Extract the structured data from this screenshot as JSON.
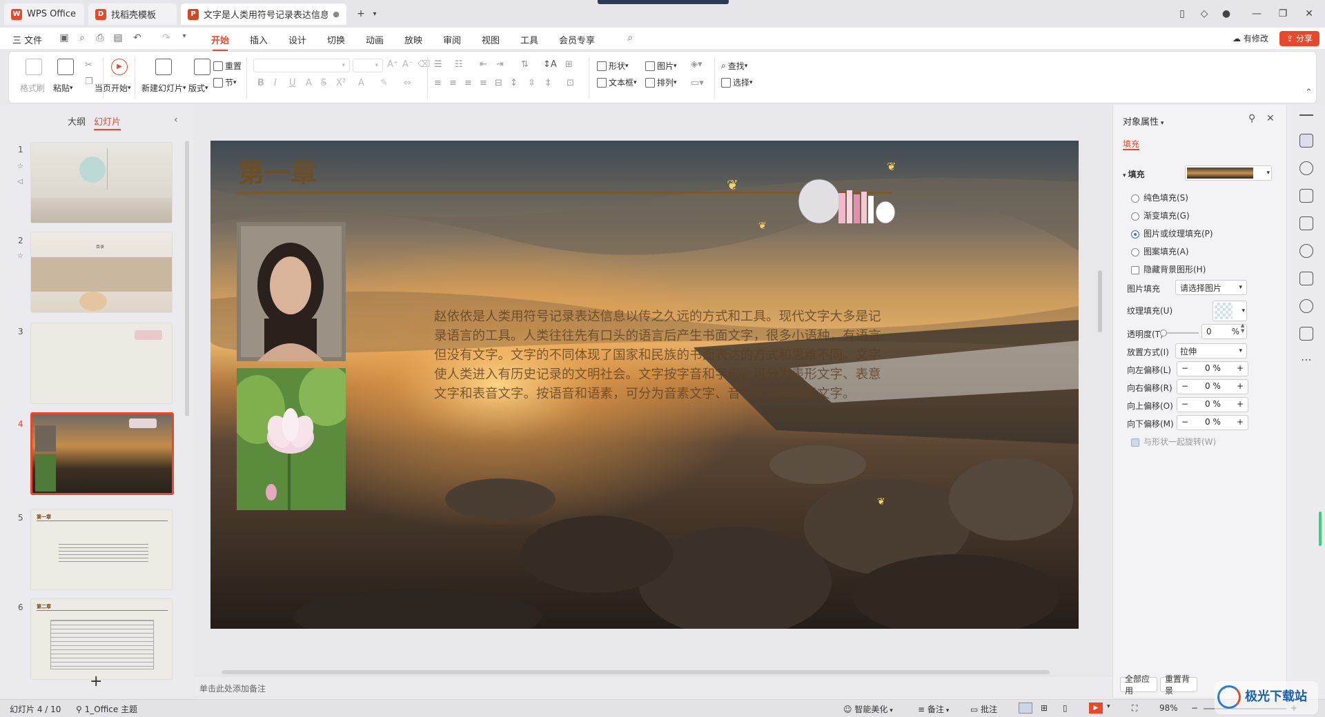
{
  "tabs": [
    {
      "label": "WPS Office",
      "icon": "wps-logo-icon",
      "color": "#e8492b"
    },
    {
      "label": "找稻壳模板",
      "icon": "docer-icon",
      "color": "#e8492b"
    },
    {
      "label": "文字是人类用符号记录表达信息以",
      "icon": "presentation-icon",
      "color": "#d24726"
    }
  ],
  "menubar": {
    "file": "三 文件",
    "items": [
      "开始",
      "插入",
      "设计",
      "切换",
      "动画",
      "放映",
      "审阅",
      "视图",
      "工具",
      "会员专享"
    ],
    "active": "开始",
    "has_changes": "有修改",
    "share": "分享"
  },
  "ribbon": {
    "format_painter": "格式刷",
    "paste": "粘贴",
    "play_from_current": "当页开始",
    "new_slide": "新建幻灯片",
    "layout": "版式",
    "section": "节",
    "reset": "重置",
    "shape": "形状",
    "picture": "图片",
    "textbox": "文本框",
    "arrange": "排列",
    "find": "查找",
    "select": "选择"
  },
  "leftpanel": {
    "outline_tab": "大纲",
    "slides_tab": "幻灯片",
    "slides": [
      {
        "num": "1"
      },
      {
        "num": "2"
      },
      {
        "num": "3"
      },
      {
        "num": "4"
      },
      {
        "num": "5"
      },
      {
        "num": "6"
      }
    ],
    "slide5_title": "第一章",
    "slide6_title": "第二章",
    "slide2_title": "目录",
    "add": "+"
  },
  "slide": {
    "title": "第一章",
    "body": "赵依依是人类用符号记录表达信息以传之久远的方式和工具。现代文字大多是记录语言的工具。人类往往先有口头的语言后产生书面文字，很多小语种，有语言但没有文字。文字的不同体现了国家和民族的书面表达的方式和思维不同。文字使人类进入有历史记录的文明社会。文字按字音和字形，可分为表形文字、表意文字和表音文字。按语音和语素，可分为音素文字、音节文字和语素文字。"
  },
  "notes_placeholder": "单击此处添加备注",
  "rightpanel": {
    "title": "对象属性",
    "tab": "填充",
    "section": "填充",
    "options": [
      "纯色填充(S)",
      "渐变填充(G)",
      "图片或纹理填充(P)",
      "图案填充(A)"
    ],
    "selected_option": "图片或纹理填充(P)",
    "hide_bg": "隐藏背景图形(H)",
    "picture_fill_label": "图片填充",
    "picture_fill_value": "请选择图片",
    "texture_fill_label": "纹理填充(U)",
    "transparency_label": "透明度(T)",
    "transparency_value": "0",
    "transparency_unit": "%",
    "placement_label": "放置方式(I)",
    "placement_value": "拉伸",
    "offsets": [
      {
        "label": "向左偏移(L)",
        "value": "0 %"
      },
      {
        "label": "向右偏移(R)",
        "value": "0 %"
      },
      {
        "label": "向上偏移(O)",
        "value": "0 %"
      },
      {
        "label": "向下偏移(M)",
        "value": "0 %"
      }
    ],
    "rotate_with_shape": "与形状一起旋转(W)",
    "apply_all": "全部应用",
    "reset_bg": "重置背景"
  },
  "statusbar": {
    "slide_info": "幻灯片 4 / 10",
    "theme": "1_Office 主题",
    "smart_beautify": "智能美化",
    "notes": "备注",
    "comments": "批注",
    "zoom": "98%"
  },
  "watermark": "极光下载站",
  "accent": "#e8492b"
}
